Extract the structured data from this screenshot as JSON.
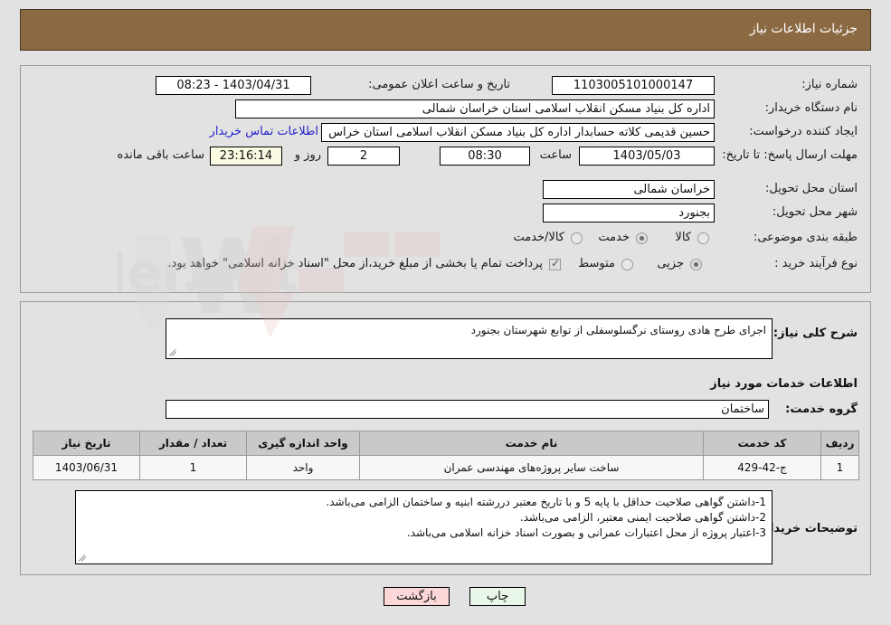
{
  "header": {
    "title": "جزئیات اطلاعات نیاز"
  },
  "top_form": {
    "need_number_label": "شماره نیاز:",
    "need_number_value": "1103005101000147",
    "announce_datetime_label": "تاریخ و ساعت اعلان عمومی:",
    "announce_datetime_value": "1403/04/31 - 08:23",
    "buyer_org_label": "نام دستگاه خریدار:",
    "buyer_org_value": "اداره کل بنیاد مسکن انقلاب اسلامی استان خراسان شمالی",
    "requester_label": "ایجاد کننده درخواست:",
    "requester_value": "حسین قدیمی کلاته حسابدار اداره کل بنیاد مسکن انقلاب اسلامی استان خراس",
    "buyer_contact_link": "اطلاعات تماس خریدار",
    "deadline_label": "مهلت ارسال پاسخ: تا تاریخ:",
    "deadline_date": "1403/05/03",
    "deadline_time_label": "ساعت",
    "deadline_time": "08:30",
    "remaining_days": "2",
    "remaining_days_label": "روز و",
    "remaining_timer": "23:16:14",
    "remaining_suffix_label": "ساعت باقی مانده",
    "province_label": "استان محل تحویل:",
    "province_value": "خراسان شمالی",
    "city_label": "شهر محل تحویل:",
    "city_value": "بجنورد",
    "category_label": "طبقه بندی موضوعی:",
    "category_options": [
      {
        "label": "کالا",
        "selected": false
      },
      {
        "label": "خدمت",
        "selected": true
      },
      {
        "label": "کالا/خدمت",
        "selected": false
      }
    ],
    "process_label": "نوع فرآیند خرید :",
    "process_options": [
      {
        "label": "جزیی",
        "selected": true
      },
      {
        "label": "متوسط",
        "selected": false
      }
    ],
    "treasury_checked": true,
    "treasury_text": "پرداخت تمام یا بخشی از مبلغ خرید،از محل \"اسناد خزانه اسلامی\" خواهد بود."
  },
  "bottom": {
    "general_desc_label": "شرح کلی نیاز:",
    "general_desc_value": "اجرای طرح هادی روستای نرگسلوسفلی از توابع شهرستان بجنورد",
    "services_section_title": "اطلاعات خدمات مورد نیاز",
    "service_group_label": "گروه خدمت:",
    "service_group_value": "ساختمان",
    "table": {
      "columns": [
        "ردیف",
        "کد خدمت",
        "نام خدمت",
        "واحد اندازه گیری",
        "تعداد / مقدار",
        "تاریخ نیاز"
      ],
      "rows": [
        [
          "1",
          "ج-42-429",
          "ساخت سایر پروژه‌های مهندسی عمران",
          "واحد",
          "1",
          "1403/06/31"
        ]
      ]
    },
    "buyer_notes_label": "توضیحات خریدار:",
    "buyer_notes_lines": [
      "1-داشتن گواهی صلاحیت حداقل با پایه 5 و با تاریخ معتبر دررشته ابنیه و ساختمان الزامی می‌باشد.",
      "2-داشتن گواهی صلاحیت ایمنی معتبر، الزامی می‌باشد.",
      "3-اعتبار پروژه از محل اعتبارات عمرانی و بصورت اسناد خزانه اسلامی می‌باشد."
    ]
  },
  "footer": {
    "print_label": "چاپ",
    "back_label": "بازگشت"
  },
  "colors": {
    "header_bar": "#8b6a43",
    "page_bg": "#e2e2e2",
    "link": "#2222cc",
    "timer_bg": "#fbfbe3",
    "table_header_bg": "#c9c9c9",
    "print_btn_bg": "#e9f7e9",
    "back_btn_bg": "#fbd7d7"
  }
}
